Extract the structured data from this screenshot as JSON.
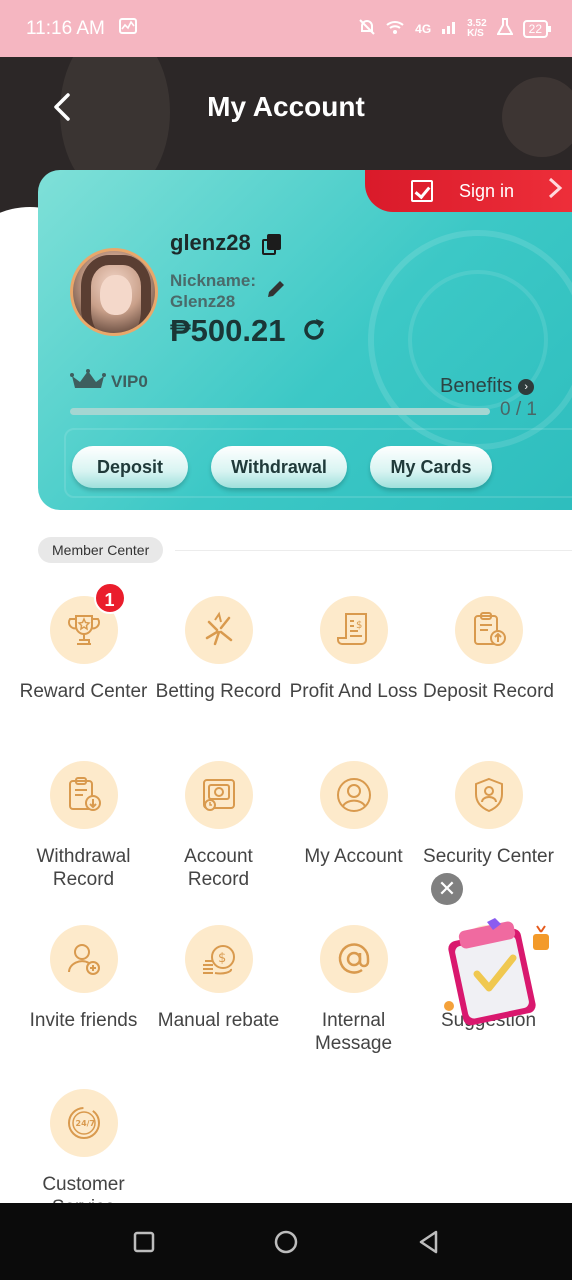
{
  "status_bar": {
    "time": "11:16 AM",
    "network": "4G",
    "speed_value": "3.52",
    "speed_unit": "K/S",
    "battery": "22"
  },
  "header": {
    "title": "My Account"
  },
  "card": {
    "sign_in_label": "Sign in",
    "username": "glenz28",
    "nickname_label": "Nickname:",
    "nickname_value": "Glenz28",
    "balance": "₱500.21",
    "vip_label": "VIP0",
    "benefits_label": "Benefits",
    "progress_text": "0 / 1",
    "progress_fraction": 0,
    "buttons": {
      "deposit": "Deposit",
      "withdrawal": "Withdrawal",
      "my_cards": "My Cards"
    }
  },
  "member_center": {
    "section_label": "Member Center",
    "items": [
      {
        "label": "Reward Center",
        "icon": "trophy-icon",
        "badge": "1"
      },
      {
        "label": "Betting Record",
        "icon": "betting-icon"
      },
      {
        "label": "Profit And Loss",
        "icon": "receipt-icon"
      },
      {
        "label": "Deposit Record",
        "icon": "deposit-clipboard-icon"
      },
      {
        "label": "Withdrawal Record",
        "icon": "withdrawal-clipboard-icon"
      },
      {
        "label": "Account Record",
        "icon": "account-record-icon"
      },
      {
        "label": "My Account",
        "icon": "user-icon"
      },
      {
        "label": "Security Center",
        "icon": "shield-icon"
      },
      {
        "label": "Invite friends",
        "icon": "invite-icon"
      },
      {
        "label": "Manual rebate",
        "icon": "coins-icon"
      },
      {
        "label": "Internal Message",
        "icon": "at-icon"
      },
      {
        "label": "Suggestion",
        "icon": "suggestion-icon"
      },
      {
        "label": "Customer Service",
        "icon": "support-24-7-icon"
      }
    ]
  },
  "floating_promo": {
    "close_label": "✕"
  },
  "colors": {
    "status_bar": "#f5b6c1",
    "header": "#2c2727",
    "card_teal": "#3cc8c6",
    "sign_in_red": "#d91a2a",
    "icon_circle": "#fdeacb",
    "icon_stroke": "#d99a4e",
    "badge_red": "#ea1d2c"
  }
}
